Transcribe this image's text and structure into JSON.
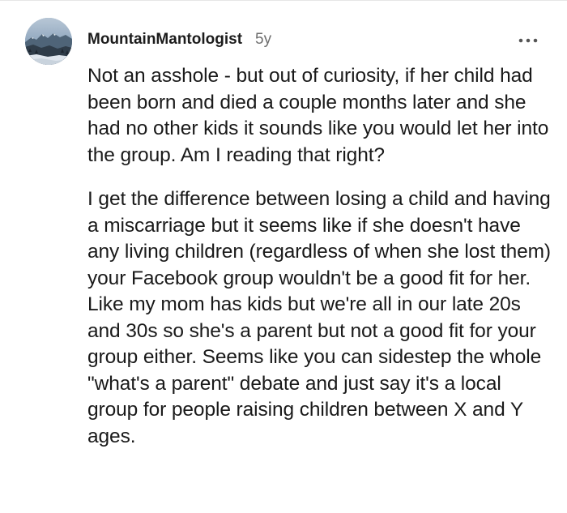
{
  "comment": {
    "username": "MountainMantologist",
    "age": "5y",
    "avatar_icon": "mountain-landscape-avatar",
    "more_icon": "more-options-icon",
    "paragraphs": [
      "Not an asshole - but out of curiosity, if her child had been born and died a couple months later and she had no other kids it sounds like you would let her into the group. Am I reading that right?",
      "I get the difference between losing a child and having a miscarriage but it seems like if she doesn't have any living children (regardless of when she lost them) your Facebook group wouldn't be a good fit for her. Like my mom has kids but we're all in our late 20s and 30s so she's a parent but not a good fit for your group either. Seems like you can sidestep the whole \"what's a parent\" debate and just say it's a local group for people raising children between X and Y ages."
    ]
  },
  "colors": {
    "text": "#1a1a1a",
    "meta": "#6f6f6f",
    "background": "#ffffff"
  }
}
